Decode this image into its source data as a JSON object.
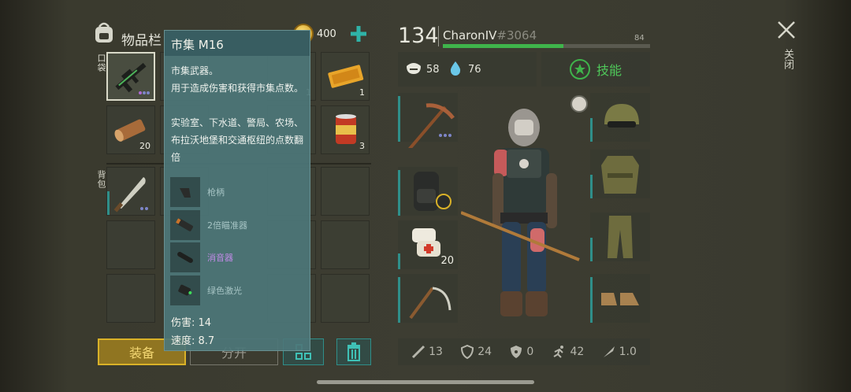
{
  "inventory": {
    "title": "物品栏",
    "pocket_label": "口袋",
    "backpack_label": "背包",
    "coins": "400",
    "slots": [
      {
        "count": ""
      },
      {
        "count": ""
      },
      {
        "count": "1"
      },
      {
        "count": "1"
      },
      {
        "count": "20"
      },
      {
        "count": ""
      },
      {
        "count": ""
      },
      {
        "count": "3"
      },
      {
        "count": ""
      },
      {
        "count": "1"
      }
    ],
    "equip_button": "装备",
    "split_button": "分开"
  },
  "tooltip": {
    "title": "市集 M16",
    "description": "市集武器。\n用于造成伤害和获得市集点数。\n\n实验室、下水道、警局、农场、布拉沃地堡和交通枢纽的点数翻倍",
    "attachments": [
      {
        "label": "枪柄",
        "icon": "grip-icon",
        "highlight": false
      },
      {
        "label": "2倍瞄准器",
        "icon": "scope-icon",
        "highlight": false
      },
      {
        "label": "消音器",
        "icon": "silencer-icon",
        "highlight": true
      },
      {
        "label": "绿色激光",
        "icon": "laser-icon",
        "highlight": false
      }
    ],
    "damage": "伤害: 14",
    "speed": "速度: 8.7"
  },
  "player": {
    "level": "134",
    "name": "CharonIV",
    "tag": "#3064",
    "xp_value": "84",
    "xp_progress": 0.58,
    "food": "58",
    "water": "76",
    "skills_label": "技能"
  },
  "equipment": {
    "left_slots": [
      {
        "name": "pickaxe-slot",
        "count": ""
      },
      {
        "name": "backpack-slot",
        "count": ""
      },
      {
        "name": "bandage-slot",
        "count": "20"
      },
      {
        "name": "sickle-slot",
        "count": ""
      }
    ],
    "right_slots": [
      {
        "name": "helmet-slot"
      },
      {
        "name": "vest-slot"
      },
      {
        "name": "pants-slot"
      },
      {
        "name": "boots-slot"
      }
    ]
  },
  "stats": {
    "attack": "13",
    "defense": "24",
    "resist": "0",
    "speed": "42",
    "misc": "1.0"
  },
  "close_label": "关闭",
  "colors": {
    "accent_green": "#3fb44b",
    "equip_yellow": "#d9b128",
    "tooltip_teal": "#4c7678",
    "highlight_purple": "#c08ae6"
  }
}
